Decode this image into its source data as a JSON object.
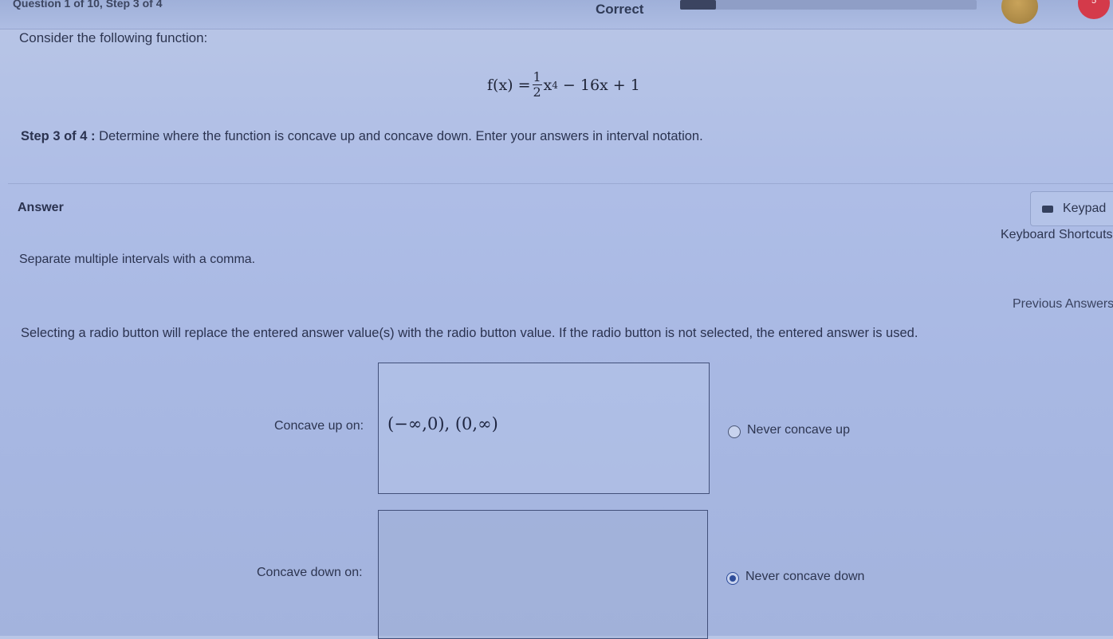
{
  "header": {
    "question_label": "Question 1 of 10, Step 3 of 4",
    "status": "Correct",
    "progress": 0.12,
    "heart_count": "5"
  },
  "question": {
    "intro": "Consider the following function:",
    "formula": {
      "lhs": "f(x) =",
      "numerator": "1",
      "denominator": "2",
      "term": "x",
      "exponent": "4",
      "rest": "− 16x + 1"
    },
    "step_label": "Step 3 of 4 :",
    "step_text": " Determine where the function is concave up and concave down. Enter your answers in interval notation."
  },
  "answer_section": {
    "title": "Answer",
    "keypad_label": "Keypad",
    "shortcuts_label": "Keyboard Shortcuts",
    "separate_note": "Separate multiple intervals with a comma.",
    "previous_answers": "Previous Answers",
    "radio_note": "Selecting a radio button will replace the entered answer value(s) with the radio button value. If the radio button is not selected, the entered answer is used."
  },
  "fields": {
    "concave_up_label": "Concave up on:",
    "concave_up_value": "(−∞,0), (0,∞)",
    "never_up_label": "Never concave up",
    "never_up_selected": false,
    "concave_down_label": "Concave down on:",
    "concave_down_value": "",
    "never_down_label": "Never concave down",
    "never_down_selected": true
  },
  "colors": {
    "accent": "#2f4d9a",
    "border": "#42507a",
    "heart": "#d43a4a"
  }
}
